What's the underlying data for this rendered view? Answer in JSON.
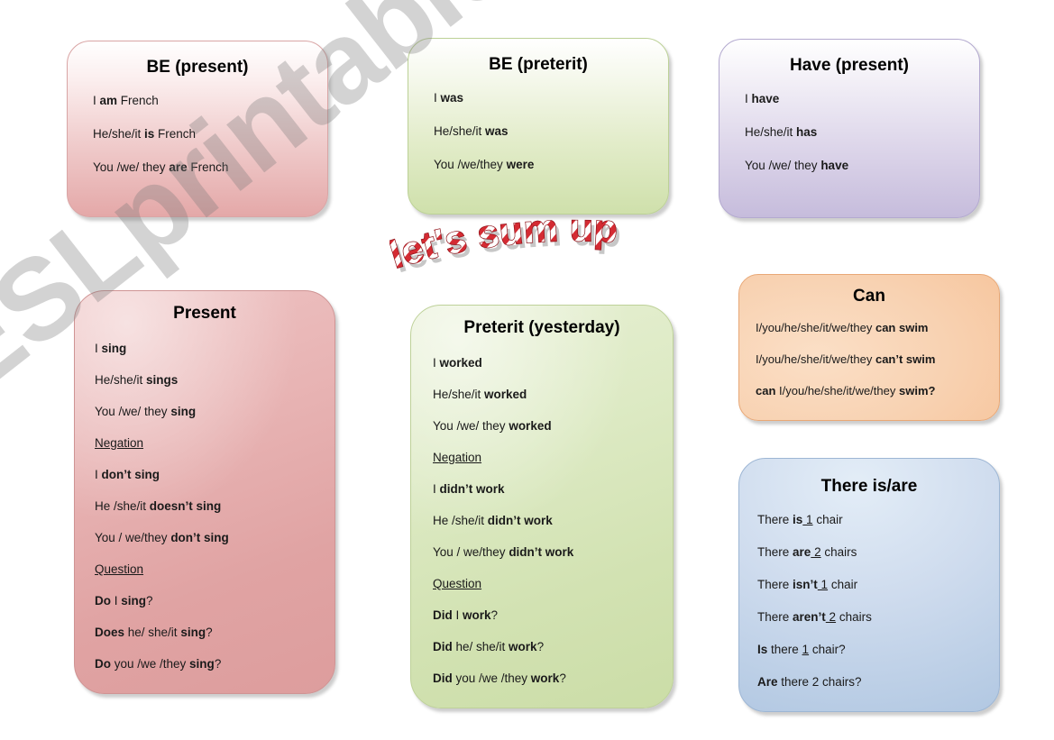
{
  "watermark": {
    "text": "ESLprintables.com"
  },
  "wordart": {
    "text": "let's sum up"
  },
  "cards": {
    "be_present": {
      "title": "BE (present)",
      "lines": [
        {
          "plain": "I ",
          "bold": "am",
          "tail": " French"
        },
        {
          "plain": "He/she/it  ",
          "bold": "is",
          "tail": " French"
        },
        {
          "plain": "You  /we/ they  ",
          "bold": "are",
          "tail": " French"
        }
      ]
    },
    "be_preterit": {
      "title": "BE (preterit)",
      "lines": [
        {
          "plain": "I ",
          "bold": "was",
          "tail": ""
        },
        {
          "plain": "He/she/it  ",
          "bold": "was",
          "tail": ""
        },
        {
          "plain": "You  /we/they  ",
          "bold": "were",
          "tail": ""
        }
      ]
    },
    "have_present": {
      "title": "Have (present)",
      "lines": [
        {
          "plain": "I ",
          "bold": "have",
          "tail": ""
        },
        {
          "plain": "He/she/it  ",
          "bold": "has",
          "tail": ""
        },
        {
          "plain": "You  /we/ they  ",
          "bold": "have",
          "tail": ""
        }
      ]
    },
    "present": {
      "title": "Present",
      "lines": [
        {
          "plain": "I ",
          "bold": "sing",
          "tail": ""
        },
        {
          "plain": "He/she/it  ",
          "bold": "sings",
          "tail": ""
        },
        {
          "plain": "You  /we/ they  ",
          "bold": "sing",
          "tail": ""
        },
        {
          "heading": "Negation"
        },
        {
          "plain": "I ",
          "bold": "don’t sing",
          "tail": ""
        },
        {
          "plain": "He /she/it  ",
          "bold": "doesn’t sing",
          "tail": ""
        },
        {
          "plain": "You / we/they ",
          "bold": "don’t sing",
          "tail": ""
        },
        {
          "heading": "Question"
        },
        {
          "bold": "Do",
          "plain2": " I ",
          "bold2": "sing",
          "tail": "?"
        },
        {
          "bold": "Does",
          "plain2": " he/ she/it ",
          "bold2": "sing",
          "tail": "?"
        },
        {
          "bold": "Do",
          "plain2": " you /we /they ",
          "bold2": "sing",
          "tail": "?"
        }
      ]
    },
    "preterit": {
      "title": "Preterit (yesterday)",
      "lines": [
        {
          "plain": "I ",
          "bold": "worked",
          "tail": ""
        },
        {
          "plain": "He/she/it  ",
          "bold": "worked",
          "tail": ""
        },
        {
          "plain": "You  /we/ they  ",
          "bold": "worked",
          "tail": ""
        },
        {
          "heading": "Negation"
        },
        {
          "plain": "I ",
          "bold": "didn’t work",
          "tail": ""
        },
        {
          "plain": "He /she/it  ",
          "bold": "didn’t  work",
          "tail": ""
        },
        {
          "plain": "You / we/they ",
          "bold": "didn’t work",
          "tail": ""
        },
        {
          "heading": "Question"
        },
        {
          "bold": "Did",
          "plain2": " I ",
          "bold2": "work",
          "tail": "?"
        },
        {
          "bold": "Did",
          "plain2": " he/ she/it ",
          "bold2": "work",
          "tail": "?"
        },
        {
          "bold": "Did",
          "plain2": " you /we /they ",
          "bold2": "work",
          "tail": "?"
        }
      ]
    },
    "can": {
      "title": "Can",
      "lines": [
        {
          "plain": "I/you/he/she/it/we/they ",
          "bold": "can swim",
          "tail": ""
        },
        {
          "plain": "I/you/he/she/it/we/they ",
          "bold": "can’t swim",
          "tail": ""
        },
        {
          "bold": "can",
          "plain2": " I/you/he/she/it/we/they ",
          "bold2": "swim?",
          "tail": ""
        }
      ]
    },
    "there_is_are": {
      "title": "There is/are",
      "lines": [
        {
          "plain": " There ",
          "bold": "is",
          "under": " 1",
          "tail": " chair"
        },
        {
          "plain": "There ",
          "bold": "are",
          "under": " 2",
          "tail": " chairs"
        },
        {
          "plain": "There ",
          "bold": "isn’t",
          "under": "  1",
          "tail": " chair"
        },
        {
          "plain": "There ",
          "bold": "aren’t",
          "under": " 2",
          "tail": " chairs"
        },
        {
          "bold": "Is",
          "plain2": " there ",
          "under": "1",
          "tail": " chair?"
        },
        {
          "bold": "Are",
          "plain2": " there 2 chairs?",
          "tail": ""
        }
      ]
    }
  },
  "colors": {
    "pink": "#e8b4b4",
    "green": "#d8e7bb",
    "purple": "#c6bcdc",
    "orange": "#f7cfa8",
    "blue": "#c2d4e8",
    "wordart_red": "#c8232c"
  }
}
